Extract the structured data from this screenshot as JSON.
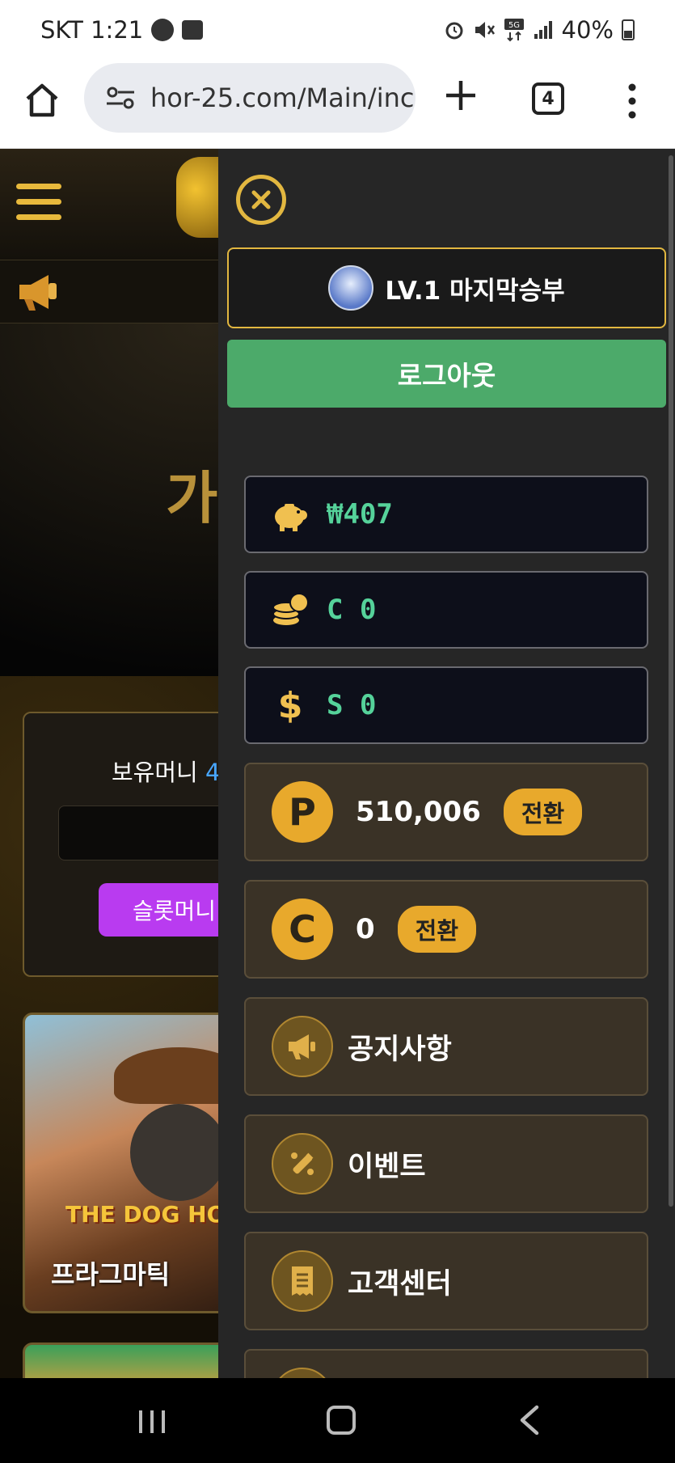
{
  "status_bar": {
    "carrier_time": "SKT 1:21",
    "battery": "40%",
    "icons": [
      "talk-icon",
      "image-icon",
      "alarm-icon",
      "mute-icon",
      "5g-icon",
      "signal-icon",
      "battery-icon"
    ]
  },
  "browser": {
    "url": "hor-25.com/Main/inc",
    "tab_count": "4"
  },
  "site": {
    "banner_text": "가입",
    "wallet_label": "보유머니",
    "wallet_value_partial": "4",
    "slot_button": "슬롯머니",
    "game_logo": "THE DOG HO",
    "game_title": "프라그마틱"
  },
  "drawer": {
    "user_level_name": "LV.1 마지막승부",
    "logout": "로그아웃",
    "balances": [
      {
        "icon": "piggy-bank-icon",
        "value": "₩407"
      },
      {
        "icon": "coins-icon",
        "value": "C 0"
      },
      {
        "icon": "dollar-icon",
        "value": "S 0"
      }
    ],
    "points": [
      {
        "symbol": "P",
        "value": "510,006",
        "button": "전환"
      },
      {
        "symbol": "C",
        "value": "0",
        "button": "전환"
      }
    ],
    "menu": [
      {
        "icon": "megaphone-icon",
        "label": "공지사항"
      },
      {
        "icon": "event-icon",
        "label": "이벤트"
      },
      {
        "icon": "receipt-icon",
        "label": "고객센터"
      }
    ]
  },
  "colors": {
    "accent_gold": "#e8a92c",
    "logout_green": "#4caa6a",
    "balance_green": "#55d29a",
    "drawer_bg": "#262626"
  }
}
